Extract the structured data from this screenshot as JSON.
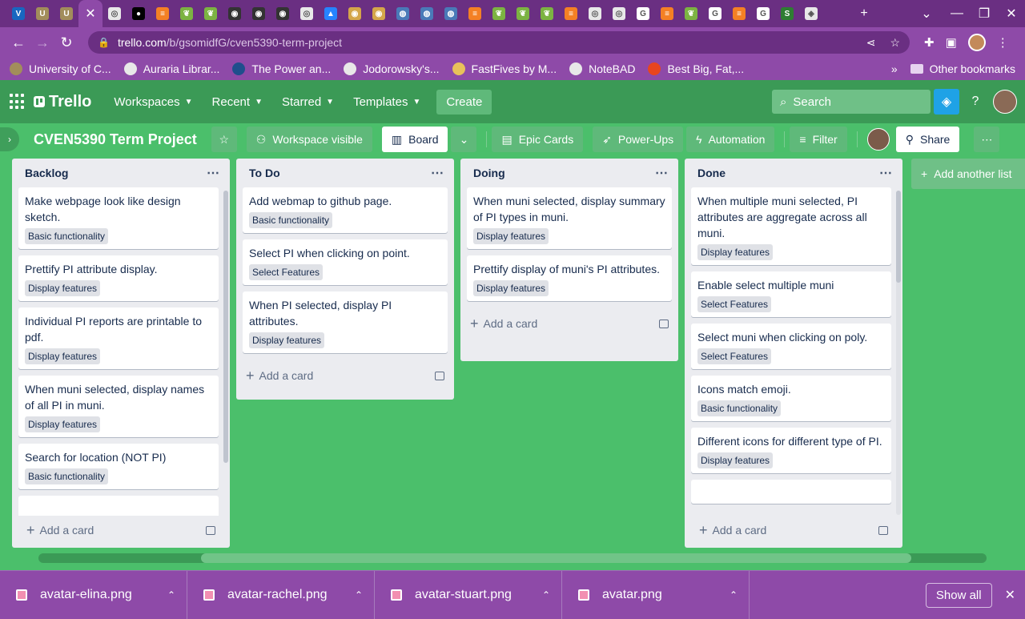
{
  "browser": {
    "tabs": [
      {
        "icon": "vuetify-icon",
        "color": "#1867c0",
        "letter": "V"
      },
      {
        "icon": "ucd-icon",
        "color": "#a28d5b",
        "letter": "U"
      },
      {
        "icon": "ucd-icon",
        "color": "#a28d5b",
        "letter": "U"
      },
      {
        "icon": "close-icon",
        "color": "",
        "letter": "✕",
        "active": true
      },
      {
        "icon": "web-icon",
        "color": "#e8e8e8",
        "letter": "◎"
      },
      {
        "icon": "medium-icon",
        "color": "#000000",
        "letter": "●"
      },
      {
        "icon": "stackoverflow-icon",
        "color": "#f48024",
        "letter": "≡"
      },
      {
        "icon": "leaf-icon",
        "color": "#7cb342",
        "letter": "❦"
      },
      {
        "icon": "leaf-icon",
        "color": "#7cb342",
        "letter": "❦"
      },
      {
        "icon": "github-icon",
        "color": "#333333",
        "letter": "◉"
      },
      {
        "icon": "github-icon",
        "color": "#333333",
        "letter": "◉"
      },
      {
        "icon": "github-icon",
        "color": "#333333",
        "letter": "◉"
      },
      {
        "icon": "web-icon",
        "color": "#e8e8e8",
        "letter": "◎"
      },
      {
        "icon": "atlassian-icon",
        "color": "#2684ff",
        "letter": "▲"
      },
      {
        "icon": "coin-icon",
        "color": "#d4a64a",
        "letter": "◉"
      },
      {
        "icon": "coin-icon",
        "color": "#d4a64a",
        "letter": "◉"
      },
      {
        "icon": "globe-icon",
        "color": "#4a7ab8",
        "letter": "◍"
      },
      {
        "icon": "globe-icon",
        "color": "#4a7ab8",
        "letter": "◍"
      },
      {
        "icon": "globe-icon",
        "color": "#4a7ab8",
        "letter": "◍"
      },
      {
        "icon": "stackoverflow-icon",
        "color": "#f48024",
        "letter": "≡"
      },
      {
        "icon": "leaf-icon",
        "color": "#7cb342",
        "letter": "❦"
      },
      {
        "icon": "leaf-icon",
        "color": "#7cb342",
        "letter": "❦"
      },
      {
        "icon": "leaf-icon",
        "color": "#7cb342",
        "letter": "❦"
      },
      {
        "icon": "stackoverflow-icon",
        "color": "#f48024",
        "letter": "≡"
      },
      {
        "icon": "web-icon",
        "color": "#e8e8e8",
        "letter": "◎"
      },
      {
        "icon": "web-icon",
        "color": "#e8e8e8",
        "letter": "◎"
      },
      {
        "icon": "google-icon",
        "color": "#ffffff",
        "letter": "G"
      },
      {
        "icon": "stackoverflow-icon",
        "color": "#f48024",
        "letter": "≡"
      },
      {
        "icon": "leaf-icon",
        "color": "#7cb342",
        "letter": "❦"
      },
      {
        "icon": "google-icon",
        "color": "#ffffff",
        "letter": "G"
      },
      {
        "icon": "stackoverflow-icon",
        "color": "#f48024",
        "letter": "≡"
      },
      {
        "icon": "google-icon",
        "color": "#ffffff",
        "letter": "G"
      },
      {
        "icon": "app-icon",
        "color": "#2e7d32",
        "letter": "S"
      },
      {
        "icon": "shield-icon",
        "color": "#e8e8e8",
        "letter": "◈"
      }
    ],
    "url_host": "trello.com",
    "url_path": "/b/gsomidfG/cven5390-term-project",
    "bookmarks": [
      {
        "label": "University of C...",
        "color": "#a28d5b"
      },
      {
        "label": "Auraria Librar...",
        "color": "#e8e8e8"
      },
      {
        "label": "The Power an...",
        "color": "#1f4e8c"
      },
      {
        "label": "Jodorowsky's...",
        "color": "#e8e8e8"
      },
      {
        "label": "FastFives by M...",
        "color": "#e8c15a"
      },
      {
        "label": "NoteBAD",
        "color": "#e8e8e8"
      },
      {
        "label": "Best Big, Fat,...",
        "color": "#e8451f"
      }
    ],
    "bookmarks_more": "»",
    "other_bookmarks": "Other bookmarks"
  },
  "trello_header": {
    "logo": "Trello",
    "menus": [
      "Workspaces",
      "Recent",
      "Starred",
      "Templates"
    ],
    "create": "Create",
    "search_placeholder": "Search"
  },
  "board": {
    "title": "CVEN5390 Term Project",
    "visibility": "Workspace visible",
    "view": "Board",
    "epic_cards": "Epic Cards",
    "power_ups": "Power-Ups",
    "automation": "Automation",
    "filter": "Filter",
    "share": "Share",
    "add_list": "Add another list"
  },
  "lists": [
    {
      "name": "Backlog",
      "add_card": "Add a card",
      "cards": [
        {
          "title": "Make webpage look like design sketch.",
          "label": "Basic functionality"
        },
        {
          "title": "Prettify PI attribute display.",
          "label": "Display features"
        },
        {
          "title": "Individual PI reports are printable to pdf.",
          "label": "Display features"
        },
        {
          "title": "When muni selected, display names of all PI in muni.",
          "label": "Display features"
        },
        {
          "title": "Search for location (NOT PI)",
          "label": "Basic functionality"
        }
      ]
    },
    {
      "name": "To Do",
      "add_card": "Add a card",
      "cards": [
        {
          "title": "Add webmap to github page.",
          "label": "Basic functionality"
        },
        {
          "title": "Select PI when clicking on point.",
          "label": "Select Features"
        },
        {
          "title": "When PI selected, display PI attributes.",
          "label": "Display features"
        }
      ]
    },
    {
      "name": "Doing",
      "add_card": "Add a card",
      "cards": [
        {
          "title": "When muni selected, display summary of PI types in muni.",
          "label": "Display features"
        },
        {
          "title": "Prettify display of muni's PI attributes.",
          "label": "Display features"
        }
      ]
    },
    {
      "name": "Done",
      "add_card": "Add a card",
      "cards": [
        {
          "title": "When multiple muni selected, PI attributes are aggregate across all muni.",
          "label": "Display features"
        },
        {
          "title": "Enable select multiple muni",
          "label": "Select Features"
        },
        {
          "title": "Select muni when clicking on poly.",
          "label": "Select Features"
        },
        {
          "title": "Icons match emoji.",
          "label": "Basic functionality"
        },
        {
          "title": "Different icons for different type of PI.",
          "label": "Display features"
        }
      ]
    }
  ],
  "downloads": {
    "files": [
      "avatar-elina.png",
      "avatar-rachel.png",
      "avatar-stuart.png",
      "avatar.png"
    ],
    "show_all": "Show all"
  },
  "colors": {
    "board_bg": "#4bbf6b",
    "header_bg": "#3b9a56",
    "browser_frame": "#8e4aa8",
    "list_bg": "#ebecf0",
    "label_bg": "#dfe1e6"
  }
}
